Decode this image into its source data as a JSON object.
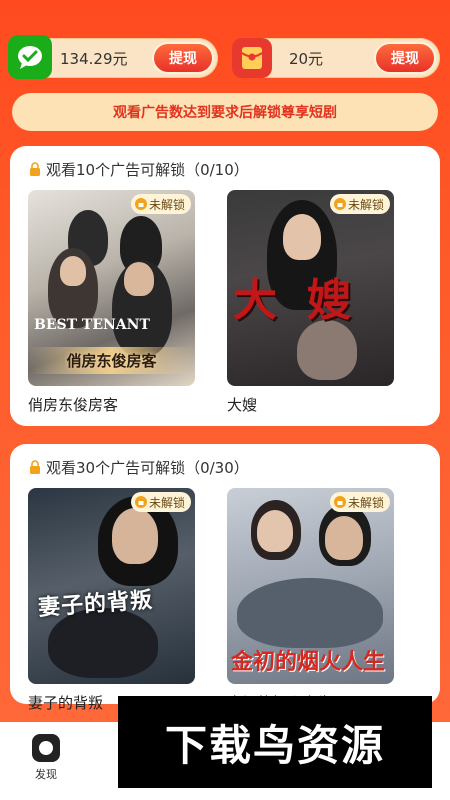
{
  "wallet": {
    "cash_amount": "134.29元",
    "cash_withdraw": "提现",
    "coupon_amount": "20元",
    "coupon_withdraw": "提现"
  },
  "notice": "观看广告数达到要求后解锁尊享短剧",
  "sections": [
    {
      "title": "观看10个广告可解锁（0/10）",
      "dramas": [
        {
          "name": "俏房东俊房客",
          "badge": "未解锁",
          "poster_text": "俏房东俊房客",
          "poster_sub": "BEST TENANT"
        },
        {
          "name": "大嫂",
          "badge": "未解锁",
          "poster_text": "大嫂"
        }
      ]
    },
    {
      "title": "观看30个广告可解锁（0/30）",
      "dramas": [
        {
          "name": "妻子的背叛",
          "badge": "未解锁",
          "poster_text": "妻子的背叛"
        },
        {
          "name": "金初的烟火人生",
          "badge": "未解锁",
          "poster_text": "金初的烟火人生"
        }
      ]
    }
  ],
  "bottom_nav": {
    "discover_label": "发现"
  },
  "watermark": "下载鸟资源",
  "colors": {
    "accent": "#e8322a",
    "background": "#ff4a1f",
    "notice_bg": "#fde2b6",
    "wallet_bg": "#fbe4c6"
  },
  "icons": {
    "cash": "wechat-icon",
    "coupon": "red-envelope-icon",
    "lock": "lock-icon",
    "discover": "discover-icon"
  }
}
